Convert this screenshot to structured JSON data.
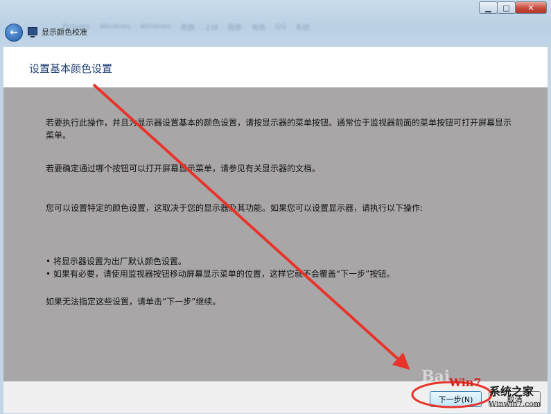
{
  "window": {
    "title": "显示颜色校准",
    "background_tabs": [
      "Pictures",
      "Windows",
      "Windows",
      "歌曲",
      "上线",
      "图册",
      "电视",
      "QQ",
      "系统"
    ],
    "caption_buttons": {
      "minimize": "▁",
      "maximize": "□",
      "close": "✕"
    },
    "back_icon": "back-arrow-icon"
  },
  "page": {
    "heading": "设置基本颜色设置",
    "paragraphs": [
      "若要执行此操作，并且为显示器设置基本的颜色设置，请按显示器的菜单按钮。通常位于监视器前面的菜单按钮可打开屏幕显示菜单。",
      "若要确定通过哪个按钮可以打开屏幕显示菜单，请参见有关显示器的文档。",
      "您可以设置特定的颜色设置，这取决于您的显示器及其功能。如果您可以设置显示器，请执行以下操作:"
    ],
    "bullets": [
      "• 将显示器设置为出厂默认颜色设置。",
      "• 如果有必要，请使用监视器按钮移动屏幕显示菜单的位置，这样它就不会覆盖“下一步”按钮。"
    ],
    "closing": "如果无法指定这些设置，请单击“下一步”继续。"
  },
  "footer": {
    "next_label": "下一步(N)",
    "cancel_label": "取消"
  },
  "watermark": {
    "baidu": "Bai",
    "logo": "Win7",
    "site_name": "系统之家",
    "url": "Winwin7.com"
  },
  "annotation": {
    "arrow_color": "#e8332a"
  }
}
